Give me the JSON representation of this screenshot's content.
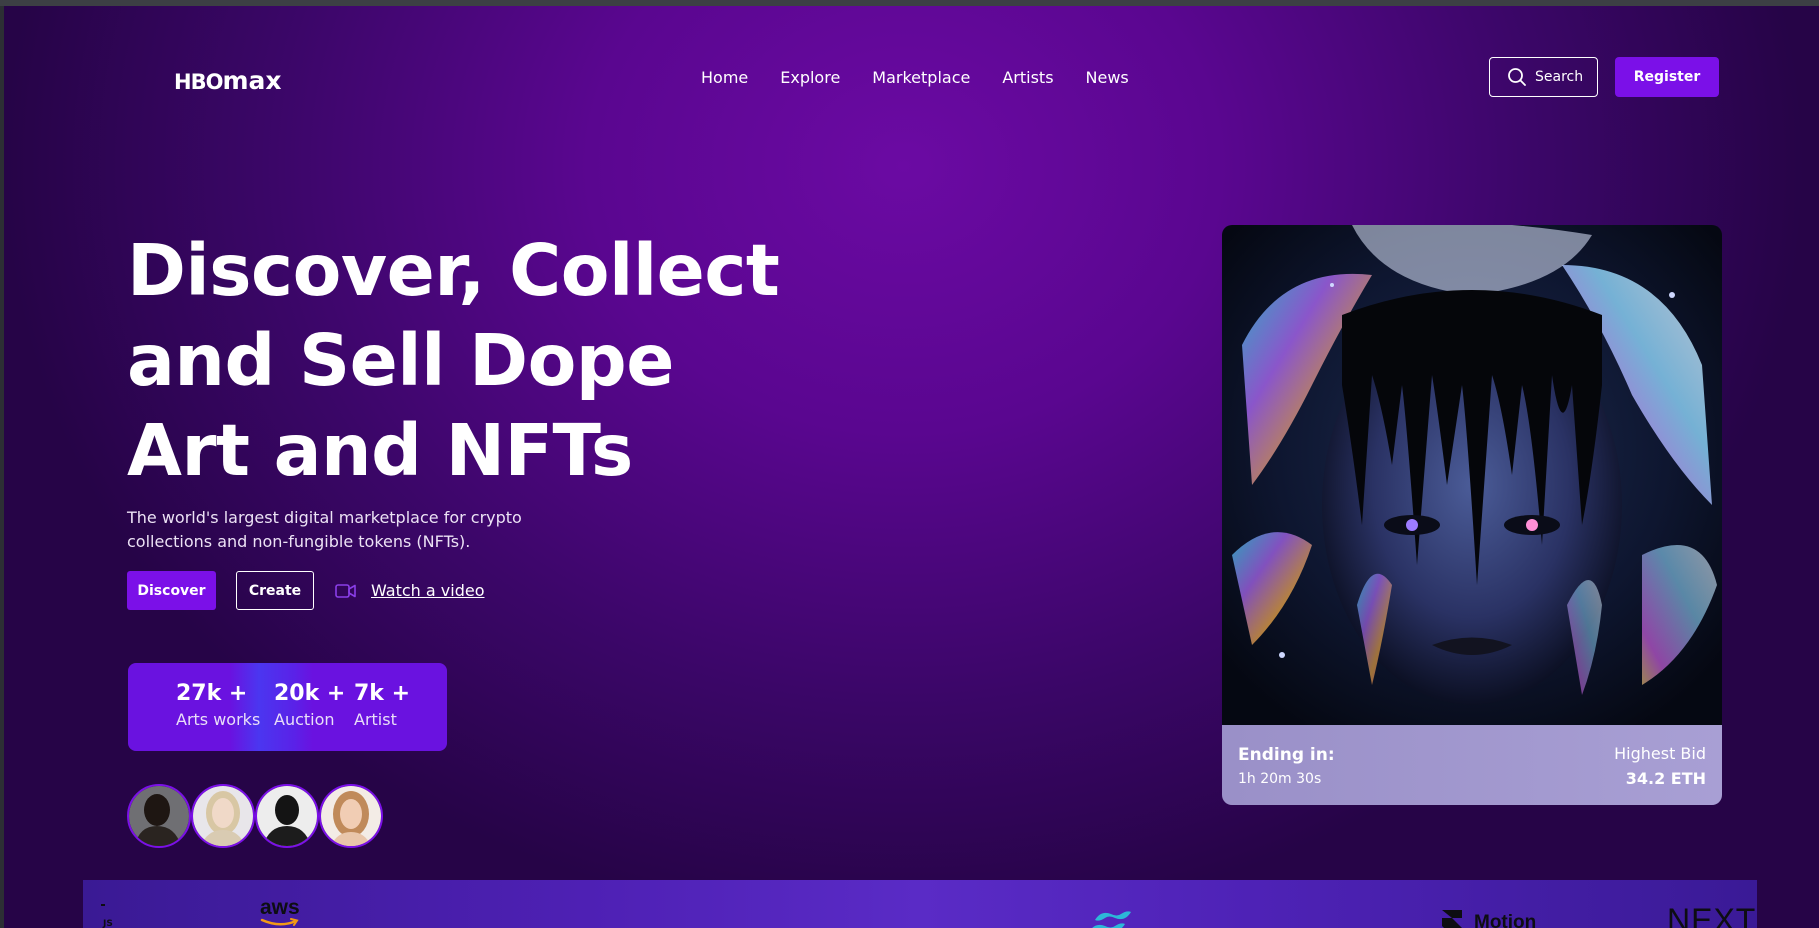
{
  "header": {
    "logo_hbo": "HBO",
    "logo_max": "max",
    "nav": [
      "Home",
      "Explore",
      "Marketplace",
      "Artists",
      "News"
    ],
    "search_label": "Search",
    "register_label": "Register"
  },
  "hero": {
    "title_lines": [
      "Discover, Collect",
      "and Sell Dope",
      "Art and NFTs"
    ],
    "subtitle": "The world's largest digital marketplace for crypto collections and non-fungible tokens (NFTs).",
    "discover_label": "Discover",
    "create_label": "Create",
    "video_label": "Watch a video"
  },
  "stats": [
    {
      "value": "27k +",
      "label": "Arts works"
    },
    {
      "value": "20k +",
      "label": "Auction"
    },
    {
      "value": "7k +",
      "label": "Artist"
    }
  ],
  "card": {
    "ending_label": "Ending in:",
    "ending_time": "1h 20m 30s",
    "bid_label": "Highest Bid",
    "bid_value": "34.2 ETH"
  },
  "brands": {
    "aws": "aws",
    "motion": "Motion",
    "next": "NEXT"
  },
  "colors": {
    "accent": "#7b10e8",
    "background": "#5a0690"
  }
}
